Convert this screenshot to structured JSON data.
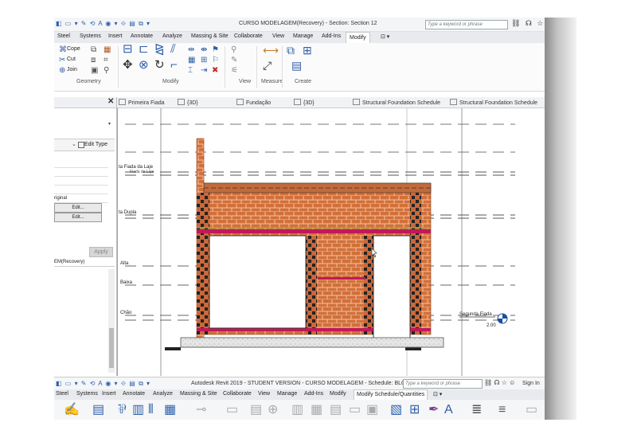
{
  "window": {
    "title": "CURSO MODELAGEM(Recovery) - Section: Section 12",
    "search_placeholder": "Type a keyword or phrase"
  },
  "ribbon_tabs": [
    "Steel",
    "Systems",
    "Insert",
    "Annotate",
    "Analyze",
    "Massing & Site",
    "Collaborate",
    "View",
    "Manage",
    "Add-Ins",
    "Modify"
  ],
  "ribbon": {
    "cope_label": "Cope",
    "cut_label": "Cut",
    "join_label": "Join",
    "panels": [
      "Geometry",
      "Modify",
      "View",
      "Measure",
      "Create"
    ]
  },
  "properties": {
    "edit_type_label": "Edit Type",
    "rows": [
      "",
      "",
      "",
      "",
      "riginal"
    ],
    "edit_buttons": [
      "Edit...",
      "Edit..."
    ],
    "apply_label": "Apply",
    "browser_title": "EM(Recovery)"
  },
  "view_tabs": [
    "Primeira Fiada",
    "{3D}",
    "Fundação",
    "{3D}",
    "Structural Foundation Schedule",
    "Structural Foundation Schedule"
  ],
  "levels": {
    "fiada_laje": "ta Fiada da Laje",
    "fiada_laje_sub": "Fiada da Laje",
    "fiada_dupla": "ta Dupla",
    "alta": "Alta",
    "baixa": "Baixa",
    "chao": "Chão",
    "segunda_fiada": "Segunda Fiada",
    "segunda_value": "2.00"
  },
  "bottom_window": {
    "title": "Autodesk Revit 2019 - STUDENT VERSION - CURSO MODELAGEM - Schedule: BLOCOS",
    "search_placeholder": "Type a keyword or phrase",
    "sign_in": "Sign In",
    "tabs": [
      "Steel",
      "Systems",
      "Insert",
      "Annotate",
      "Analyze",
      "Massing & Site",
      "Collaborate",
      "View",
      "Manage",
      "Add-Ins",
      "Modify",
      "Modify Schedule/Quantities"
    ]
  },
  "colors": {
    "brick": "#d2703a",
    "mortar": "#f2c2a0",
    "beam": "#c2185b",
    "accent": "#2e5fa8"
  }
}
